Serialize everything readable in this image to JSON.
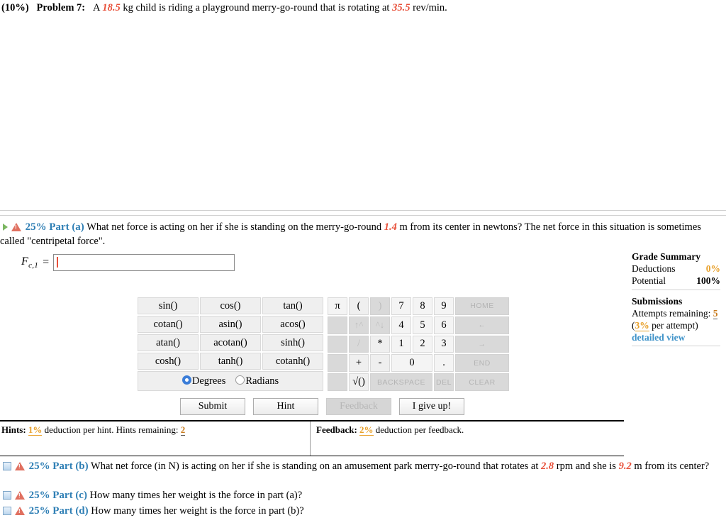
{
  "problem": {
    "weight": "(10%)",
    "label": "Problem 7:",
    "text_1": "A ",
    "mass": "18.5",
    "text_2": " kg child is riding a playground merry-go-round that is rotating at ",
    "rpm": "35.5",
    "text_3": " rev/min."
  },
  "parts": {
    "a": {
      "pct": "25%",
      "label": "Part (a)",
      "text_1": "What net force is acting on her if she is standing on the merry-go-round ",
      "radius": "1.4",
      "text_2": " m from its center in newtons? The net force in this situation is sometimes called \"centripetal force\"."
    },
    "b": {
      "pct": "25%",
      "label": "Part (b)",
      "text_1": "What net force (in N) is acting on her if she is standing on an amusement park merry-go-round that rotates at ",
      "rpm": "2.8",
      "text_2": " rpm and she is ",
      "radius": "9.2",
      "text_3": " m from its center?"
    },
    "c": {
      "pct": "25%",
      "label": "Part (c)",
      "text": "How many times her weight is the force in part (a)?"
    },
    "d": {
      "pct": "25%",
      "label": "Part (d)",
      "text": "How many times her weight is the force in part (b)?"
    }
  },
  "answer": {
    "symbol": "F",
    "subscript": "c,1",
    "equals": "=",
    "value": "",
    "placeholder": ""
  },
  "grade_summary": {
    "title": "Grade Summary",
    "deductions_label": "Deductions",
    "deductions_value": "0%",
    "potential_label": "Potential",
    "potential_value": "100%",
    "submissions_title": "Submissions",
    "attempts_label": "Attempts remaining:",
    "attempts_value": "5",
    "per_attempt_open": "(",
    "per_attempt_pct": "3%",
    "per_attempt_rest": " per attempt)",
    "detailed_view": "detailed view"
  },
  "keypad": {
    "functions": [
      [
        "sin()",
        "cos()",
        "tan()"
      ],
      [
        "cotan()",
        "asin()",
        "acos()"
      ],
      [
        "atan()",
        "acotan()",
        "sinh()"
      ],
      [
        "cosh()",
        "tanh()",
        "cotanh()"
      ]
    ],
    "angle_mode": {
      "degrees_label": "Degrees",
      "radians_label": "Radians",
      "selected": "Degrees"
    },
    "numeric": {
      "pi": "π",
      "paren_open": "(",
      "paren_close": ")",
      "seven": "7",
      "eight": "8",
      "nine": "9",
      "four": "4",
      "five": "5",
      "six": "6",
      "one": "1",
      "two": "2",
      "three": "3",
      "zero": "0",
      "dot": ".",
      "plus": "+",
      "minus": "-",
      "times": "*",
      "divide": "/",
      "pow_up": "↑^",
      "pow_down": "^↓",
      "sqrt": "√()",
      "home": "HOME",
      "arrow_left": "←",
      "arrow_right": "→",
      "end": "END",
      "backspace": "BACKSPACE",
      "del": "DEL",
      "clear": "CLEAR"
    }
  },
  "buttons": {
    "submit": "Submit",
    "hint": "Hint",
    "feedback": "Feedback",
    "give_up": "I give up!"
  },
  "hints_bar": {
    "hints_label": "Hints:",
    "hints_pct": "1%",
    "hints_text": " deduction per hint. Hints remaining: ",
    "hints_remaining": "2",
    "feedback_label": "Feedback:",
    "feedback_pct": "2%",
    "feedback_text": " deduction per feedback."
  },
  "colors": {
    "accent_blue": "#2f7fb5",
    "value_red": "#e8503a",
    "orange": "#e8a02a",
    "link_blue": "#3f93c9"
  }
}
